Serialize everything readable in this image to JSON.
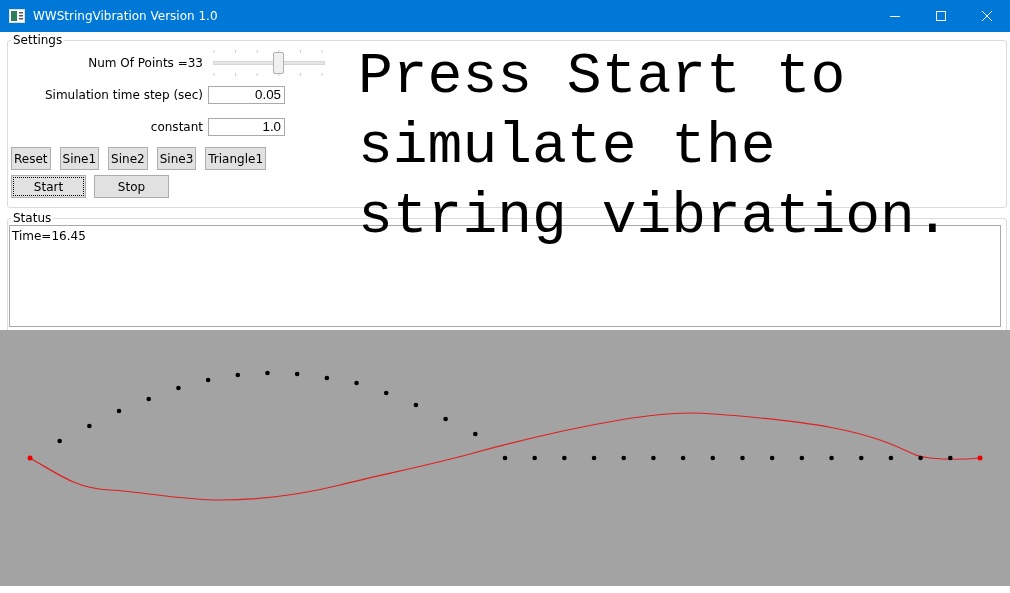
{
  "window": {
    "title": "WWStringVibration Version 1.0"
  },
  "settings": {
    "title": "Settings",
    "num_points": {
      "label": "Num Of Points =33",
      "level": 0.6
    },
    "time_step": {
      "label": "Simulation time step (sec)",
      "value": "0.05"
    },
    "constant": {
      "label": "constant",
      "value": "1.0"
    },
    "shape_buttons": [
      {
        "label": "Reset",
        "focused": false
      },
      {
        "label": "Sine1",
        "focused": false
      },
      {
        "label": "Sine2",
        "focused": false
      },
      {
        "label": "Sine3",
        "focused": false
      },
      {
        "label": "Triangle1",
        "focused": false
      }
    ],
    "run_buttons": [
      {
        "label": "Start",
        "focused": true
      },
      {
        "label": "Stop",
        "focused": false
      }
    ]
  },
  "status": {
    "title": "Status",
    "text": "Time=16.45"
  },
  "caption": [
    "Press Start to",
    "simulate the",
    "string vibration."
  ]
}
